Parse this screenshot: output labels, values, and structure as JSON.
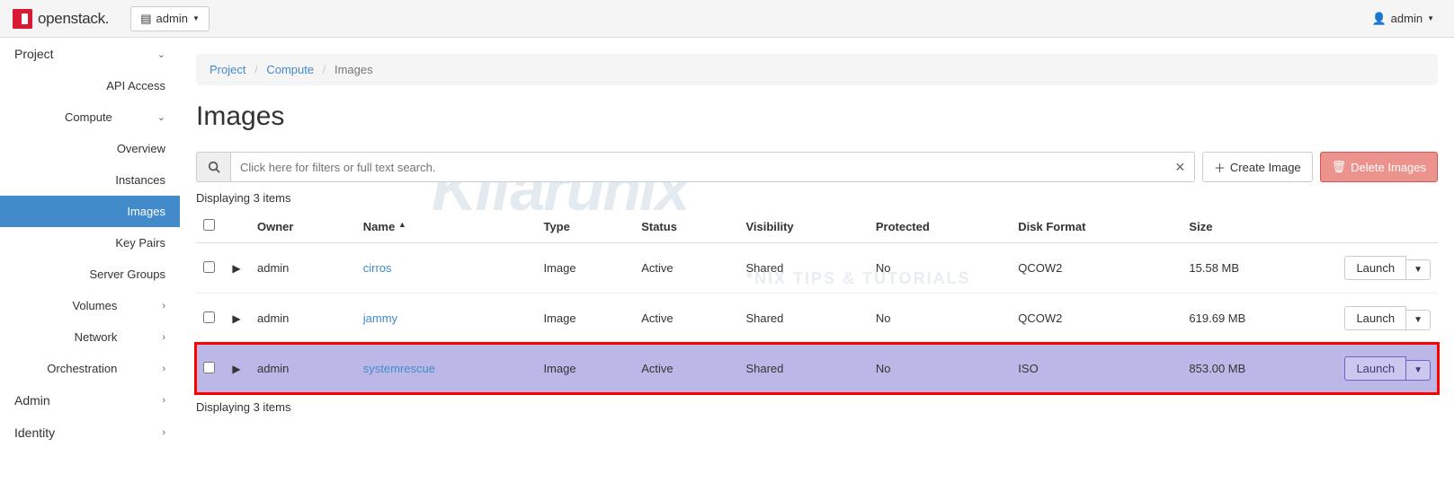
{
  "topbar": {
    "brand": "openstack.",
    "project_selector": "admin",
    "user": "admin"
  },
  "sidebar": {
    "project": "Project",
    "api_access": "API Access",
    "compute": "Compute",
    "overview": "Overview",
    "instances": "Instances",
    "images": "Images",
    "keypairs": "Key Pairs",
    "servergroups": "Server Groups",
    "volumes": "Volumes",
    "network": "Network",
    "orchestration": "Orchestration",
    "admin": "Admin",
    "identity": "Identity"
  },
  "breadcrumb": {
    "a": "Project",
    "b": "Compute",
    "c": "Images"
  },
  "page": {
    "title": "Images"
  },
  "toolbar": {
    "search_placeholder": "Click here for filters or full text search.",
    "create": "Create Image",
    "delete": "Delete Images"
  },
  "table": {
    "displaying": "Displaying 3 items",
    "headers": {
      "owner": "Owner",
      "name": "Name",
      "type": "Type",
      "status": "Status",
      "visibility": "Visibility",
      "protected": "Protected",
      "diskformat": "Disk Format",
      "size": "Size"
    },
    "rows": [
      {
        "owner": "admin",
        "name": "cirros",
        "type": "Image",
        "status": "Active",
        "visibility": "Shared",
        "protected": "No",
        "diskformat": "QCOW2",
        "size": "15.58 MB",
        "action": "Launch"
      },
      {
        "owner": "admin",
        "name": "jammy",
        "type": "Image",
        "status": "Active",
        "visibility": "Shared",
        "protected": "No",
        "diskformat": "QCOW2",
        "size": "619.69 MB",
        "action": "Launch"
      },
      {
        "owner": "admin",
        "name": "systemrescue",
        "type": "Image",
        "status": "Active",
        "visibility": "Shared",
        "protected": "No",
        "diskformat": "ISO",
        "size": "853.00 MB",
        "action": "Launch"
      }
    ]
  },
  "watermark": {
    "main": "Kifarunix",
    "sub": "*NIX TIPS & TUTORIALS"
  }
}
